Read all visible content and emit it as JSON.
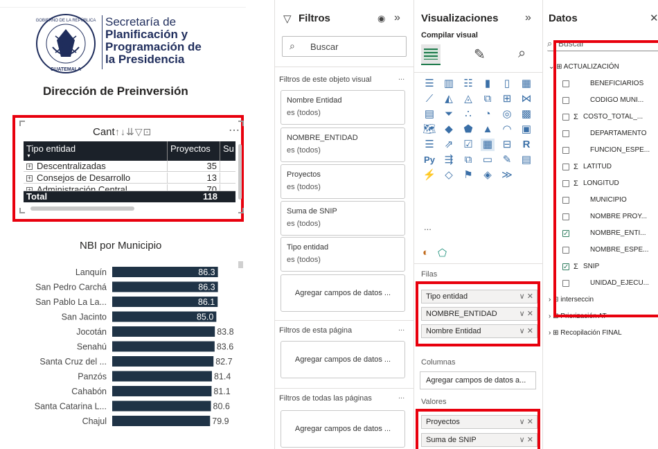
{
  "logo": {
    "line1": "Secretaría de",
    "line2": "Planificación y",
    "line3": "Programación de",
    "line4": "la Presidencia",
    "seal_top": "GOBIERNO DE LA REPÚBLICA",
    "seal_bottom": "GUATEMALA"
  },
  "page_heading": "Dirección de Preinversión",
  "matrix": {
    "title": "Cant",
    "columns": [
      "Tipo entidad",
      "Proyectos",
      "Su"
    ],
    "rows": [
      {
        "label": "Descentralizadas",
        "value": "35"
      },
      {
        "label": "Consejos de Desarrollo",
        "value": "13"
      },
      {
        "label": "Administración Central",
        "value": "70"
      }
    ],
    "total_label": "Total",
    "total_value": "118"
  },
  "chart_data": {
    "type": "bar",
    "orientation": "horizontal",
    "title": "NBI por Municipio",
    "categories": [
      "Lanquín",
      "San Pedro Carchá",
      "San Pablo La La...",
      "San Jacinto",
      "Jocotán",
      "Senahú",
      "Santa Cruz del ...",
      "Panzós",
      "Cahabón",
      "Santa Catarina L...",
      "Chajul"
    ],
    "values": [
      86.3,
      86.3,
      86.1,
      85.0,
      83.8,
      83.6,
      82.7,
      81.4,
      81.1,
      80.6,
      79.9
    ],
    "value_labels": [
      "86.3",
      "86.3",
      "86.1",
      "85.0",
      "83.8",
      "83.6",
      "82.7",
      "81.4",
      "81.1",
      "80.6",
      "79.9"
    ],
    "bar_color": "#1f3346",
    "xlim": [
      0,
      95
    ]
  },
  "filters": {
    "title": "Filtros",
    "search_placeholder": "Buscar",
    "visual_section": "Filtros de este objeto visual",
    "page_section": "Filtros de esta página",
    "all_pages_section": "Filtros de todas las páginas",
    "more": "...",
    "cards": [
      {
        "name": "Nombre Entidad",
        "state": "es (todos)"
      },
      {
        "name": "NOMBRE_ENTIDAD",
        "state": "es (todos)"
      },
      {
        "name": "Proyectos",
        "state": "es (todos)"
      },
      {
        "name": "Suma de SNIP",
        "state": "es (todos)"
      },
      {
        "name": "Tipo entidad",
        "state": "es (todos)"
      }
    ],
    "add_fields": "Agregar campos de datos ..."
  },
  "visualizations": {
    "title": "Visualizaciones",
    "subtitle": "Compilar visual",
    "more": "...",
    "rows_label": "Filas",
    "rows_fields": [
      "Tipo entidad",
      "NOMBRE_ENTIDAD",
      "Nombre Entidad"
    ],
    "columns_label": "Columnas",
    "columns_add": "Agregar campos de datos a...",
    "values_label": "Valores",
    "values_fields": [
      "Proyectos",
      "Suma de SNIP"
    ],
    "icons": [
      "stacked-bar",
      "clustered-bar",
      "stacked-bar-100",
      "stacked-column",
      "clustered-column",
      "stacked-column-100",
      "line",
      "area",
      "stacked-area",
      "line-clustered-column",
      "line-stacked-column",
      "ribbon",
      "waterfall",
      "funnel",
      "scatter",
      "pie",
      "donut",
      "treemap",
      "map",
      "filled-map",
      "shape-map",
      "azure-map",
      "gauge",
      "card",
      "multi-row-card",
      "kpi",
      "slicer",
      "table",
      "matrix",
      "r-visual",
      "python-visual",
      "key-influencers",
      "decomposition-tree",
      "qa",
      "smart-narrative",
      "paginated",
      "power-apps",
      "power-automate",
      "metrics",
      "diamond",
      "chevrons"
    ],
    "r_label": "R",
    "py_label": "Py"
  },
  "data": {
    "title": "Datos",
    "search_placeholder": "Buscar",
    "tables": [
      {
        "name": "ACTUALIZACIÓN",
        "fields": [
          {
            "name": "BENEFICIARIOS",
            "sum": false,
            "checked": false
          },
          {
            "name": "CODIGO MUNI...",
            "sum": false,
            "checked": false
          },
          {
            "name": "COSTO_TOTAL_...",
            "sum": true,
            "checked": false
          },
          {
            "name": "DEPARTAMENTO",
            "sum": false,
            "checked": false
          },
          {
            "name": "FUNCION_ESPE...",
            "sum": false,
            "checked": false
          },
          {
            "name": "LATITUD",
            "sum": true,
            "checked": false
          },
          {
            "name": "LONGITUD",
            "sum": true,
            "checked": false
          },
          {
            "name": "MUNICIPIO",
            "sum": false,
            "checked": false
          },
          {
            "name": "NOMBRE PROY...",
            "sum": false,
            "checked": false
          },
          {
            "name": "NOMBRE_ENTI...",
            "sum": false,
            "checked": true
          },
          {
            "name": "NOMBRE_ESPE...",
            "sum": false,
            "checked": false
          },
          {
            "name": "SNIP",
            "sum": true,
            "checked": true
          },
          {
            "name": "UNIDAD_EJECU...",
            "sum": false,
            "checked": false
          }
        ]
      },
      {
        "name": "interseccin"
      },
      {
        "name": "Priorización AT"
      },
      {
        "name": "Recopilación FINAL"
      }
    ]
  }
}
